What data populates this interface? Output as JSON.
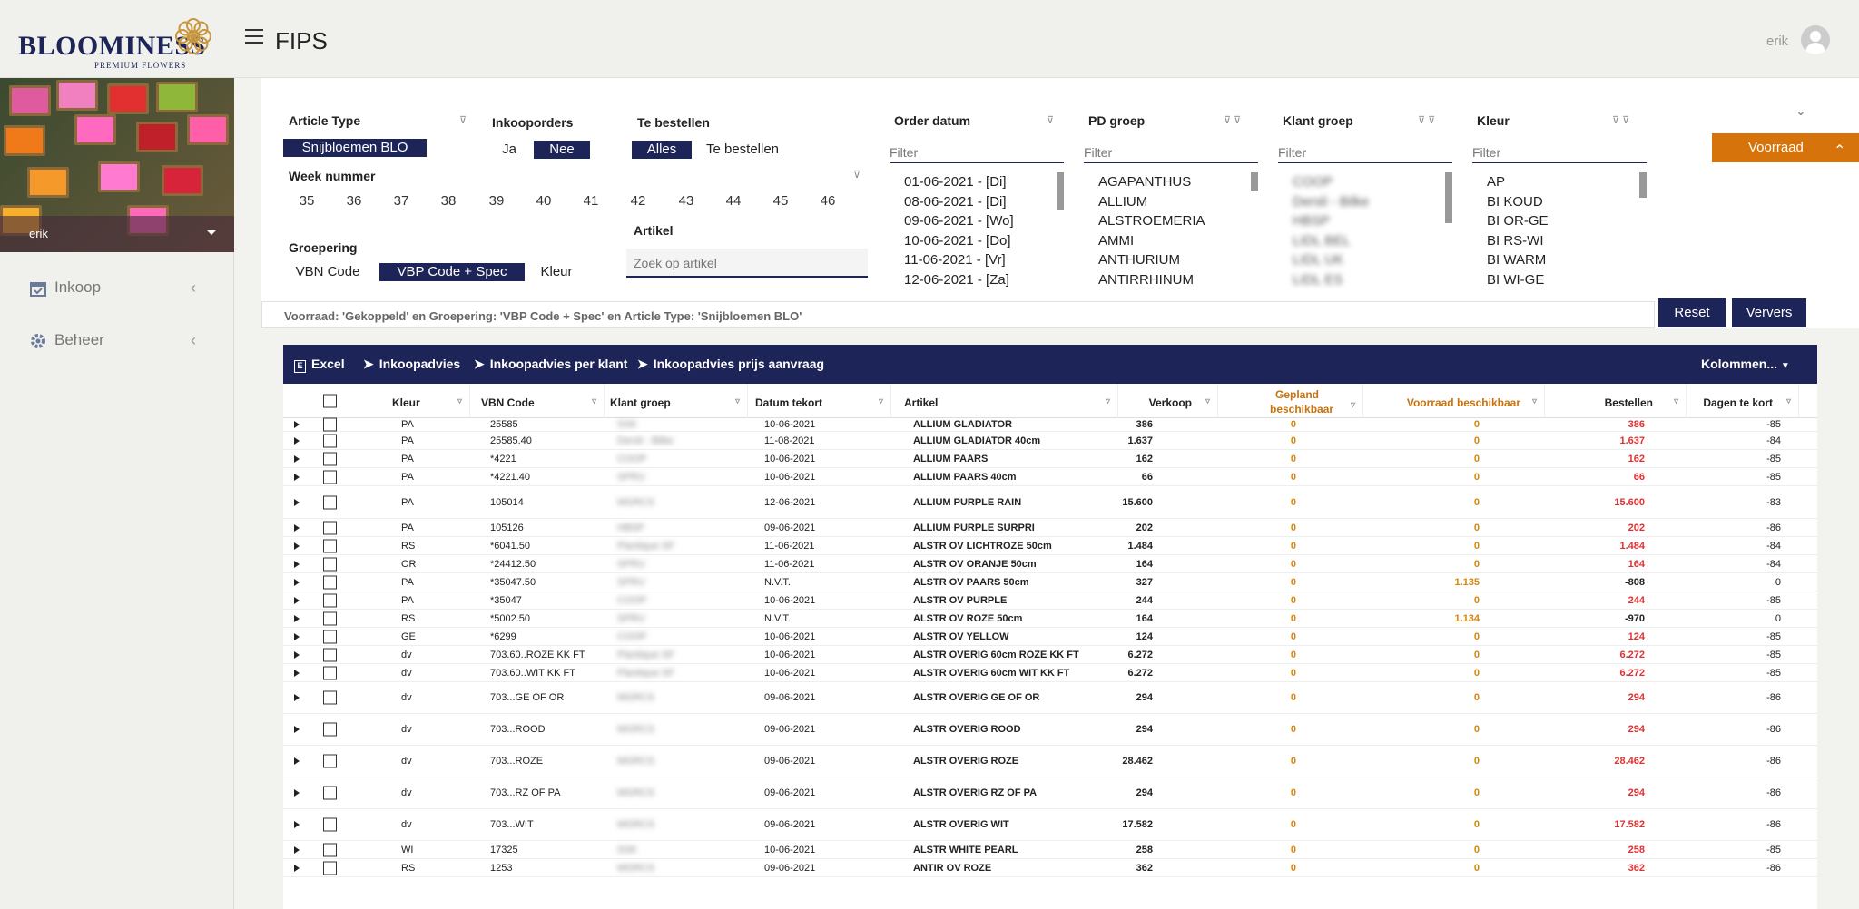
{
  "app": {
    "brand": "BLOOMINESS",
    "brand_sub": "PREMIUM FLOWERS",
    "title": "FIPS",
    "user": "erik"
  },
  "sidebar": {
    "user": "erik",
    "items": [
      {
        "label": "Inkoop",
        "icon": "calendar-check-icon"
      },
      {
        "label": "Beheer",
        "icon": "gear-icon"
      }
    ]
  },
  "filters": {
    "article_type": {
      "label": "Article Type",
      "value": "Snijbloemen BLO"
    },
    "inkooporders": {
      "label": "Inkooporders",
      "options": [
        "Ja",
        "Nee"
      ],
      "selected": "Nee"
    },
    "te_bestellen": {
      "label": "Te bestellen",
      "options": [
        "Alles",
        "Te bestellen"
      ],
      "selected": "Alles"
    },
    "week": {
      "label": "Week nummer",
      "values": [
        "35",
        "36",
        "37",
        "38",
        "39",
        "40",
        "41",
        "42",
        "43",
        "44",
        "45",
        "46"
      ]
    },
    "groepering": {
      "label": "Groepering",
      "options": [
        "VBN Code",
        "VBP Code + Spec",
        "Kleur"
      ],
      "selected": "VBP Code + Spec"
    },
    "artikel": {
      "label": "Artikel",
      "placeholder": "Zoek op artikel"
    },
    "order_datum": {
      "label": "Order datum",
      "placeholder": "Filter",
      "items": [
        "01-06-2021 - [Di]",
        "08-06-2021 - [Di]",
        "09-06-2021 - [Wo]",
        "10-06-2021 - [Do]",
        "11-06-2021 - [Vr]",
        "12-06-2021 - [Za]"
      ]
    },
    "pd_groep": {
      "label": "PD groep",
      "placeholder": "Filter",
      "items": [
        "AGAPANTHUS",
        "ALLIUM",
        "ALSTROEMERIA",
        "AMMI",
        "ANTHURIUM",
        "ANTIRRHINUM"
      ]
    },
    "klant_groep": {
      "label": "Klant groep",
      "placeholder": "Filter",
      "items": [
        "COOP",
        "Dersli - Bilke",
        "HBSP",
        "LIDL BEL",
        "LIDL UK",
        "LIDL ES"
      ]
    },
    "kleur": {
      "label": "Kleur",
      "placeholder": "Filter",
      "items": [
        "AP",
        "BI KOUD",
        "BI OR-GE",
        "BI RS-WI",
        "BI WARM",
        "BI WI-GE"
      ]
    }
  },
  "voorraad_button": "Voorraad",
  "summary": "Voorraad: 'Gekoppeld' en Groepering: 'VBP Code + Spec' en Article Type: 'Snijbloemen BLO'",
  "buttons": {
    "reset": "Reset",
    "refresh": "Ververs"
  },
  "toolbar": {
    "excel": "Excel",
    "inkoopadvies": "Inkoopadvies",
    "per_klant": "Inkoopadvies per klant",
    "prijs": "Inkoopadvies prijs aanvraag",
    "kolommen": "Kolommen..."
  },
  "columns": [
    "Kleur",
    "VBN Code",
    "Klant groep",
    "Datum tekort",
    "Artikel",
    "Verkoop",
    "Gepland beschikbaar",
    "Voorraad beschikbaar",
    "Bestellen",
    "Dagen te kort"
  ],
  "rows": [
    [
      "PA",
      "25585",
      "SSK",
      "10-06-2021",
      "ALLIUM GLADIATOR",
      "386",
      "0",
      "0",
      "386",
      "-85"
    ],
    [
      "PA",
      "25585.40",
      "Dersli - Bilke",
      "11-08-2021",
      "ALLIUM GLADIATOR 40cm",
      "1.637",
      "0",
      "0",
      "1.637",
      "-84"
    ],
    [
      "PA",
      "*4221",
      "COOP",
      "10-06-2021",
      "ALLIUM PAARS",
      "162",
      "0",
      "0",
      "162",
      "-85"
    ],
    [
      "PA",
      "*4221.40",
      "SPRU",
      "10-06-2021",
      "ALLIUM PAARS 40cm",
      "66",
      "0",
      "0",
      "66",
      "-85"
    ],
    [
      "PA",
      "105014",
      "MGRCS",
      "12-06-2021",
      "ALLIUM PURPLE RAIN",
      "15.600",
      "0",
      "0",
      "15.600",
      "-83"
    ],
    [
      "PA",
      "105126",
      "HBSP",
      "09-06-2021",
      "ALLIUM PURPLE SURPRI",
      "202",
      "0",
      "0",
      "202",
      "-86"
    ],
    [
      "RS",
      "*6041.50",
      "Plantique SF",
      "11-06-2021",
      "ALSTR OV LICHTROZE 50cm",
      "1.484",
      "0",
      "0",
      "1.484",
      "-84"
    ],
    [
      "OR",
      "*24412.50",
      "SPRU",
      "11-06-2021",
      "ALSTR OV ORANJE 50cm",
      "164",
      "0",
      "0",
      "164",
      "-84"
    ],
    [
      "PA",
      "*35047.50",
      "SPRU",
      "N.V.T.",
      "ALSTR OV PAARS 50cm",
      "327",
      "0",
      "1.135",
      "-808",
      "0"
    ],
    [
      "PA",
      "*35047",
      "COOP",
      "10-06-2021",
      "ALSTR OV PURPLE",
      "244",
      "0",
      "0",
      "244",
      "-85"
    ],
    [
      "RS",
      "*5002.50",
      "SPRU",
      "N.V.T.",
      "ALSTR OV ROZE 50cm",
      "164",
      "0",
      "1.134",
      "-970",
      "0"
    ],
    [
      "GE",
      "*6299",
      "COOP",
      "10-06-2021",
      "ALSTR OV YELLOW",
      "124",
      "0",
      "0",
      "124",
      "-85"
    ],
    [
      "dv",
      "703.60..ROZE KK FT",
      "Plantique SF",
      "10-06-2021",
      "ALSTR OVERIG 60cm ROZE KK FT",
      "6.272",
      "0",
      "0",
      "6.272",
      "-85"
    ],
    [
      "dv",
      "703.60..WIT KK FT",
      "Plantique SF",
      "10-06-2021",
      "ALSTR OVERIG 60cm WIT KK FT",
      "6.272",
      "0",
      "0",
      "6.272",
      "-85"
    ],
    [
      "dv",
      "703...GE OF OR",
      "MGRCS",
      "09-06-2021",
      "ALSTR OVERIG GE OF OR",
      "294",
      "0",
      "0",
      "294",
      "-86"
    ],
    [
      "dv",
      "703...ROOD",
      "MGRCS",
      "09-06-2021",
      "ALSTR OVERIG ROOD",
      "294",
      "0",
      "0",
      "294",
      "-86"
    ],
    [
      "dv",
      "703...ROZE",
      "MGRCS",
      "09-06-2021",
      "ALSTR OVERIG ROZE",
      "28.462",
      "0",
      "0",
      "28.462",
      "-86"
    ],
    [
      "dv",
      "703...RZ OF PA",
      "MGRCS",
      "09-06-2021",
      "ALSTR OVERIG RZ OF PA",
      "294",
      "0",
      "0",
      "294",
      "-86"
    ],
    [
      "dv",
      "703...WIT",
      "MGRCS",
      "09-06-2021",
      "ALSTR OVERIG WIT",
      "17.582",
      "0",
      "0",
      "17.582",
      "-86"
    ],
    [
      "WI",
      "17325",
      "SSK",
      "10-06-2021",
      "ALSTR WHITE PEARL",
      "258",
      "0",
      "0",
      "258",
      "-85"
    ],
    [
      "RS",
      "1253",
      "MGRCS",
      "09-06-2021",
      "ANTIR OV ROZE",
      "362",
      "0",
      "0",
      "362",
      "-86"
    ]
  ],
  "colors": {
    "navy": "#1d2457",
    "orange": "#d7730b",
    "red": "#e13030",
    "amber": "#d7860c"
  }
}
